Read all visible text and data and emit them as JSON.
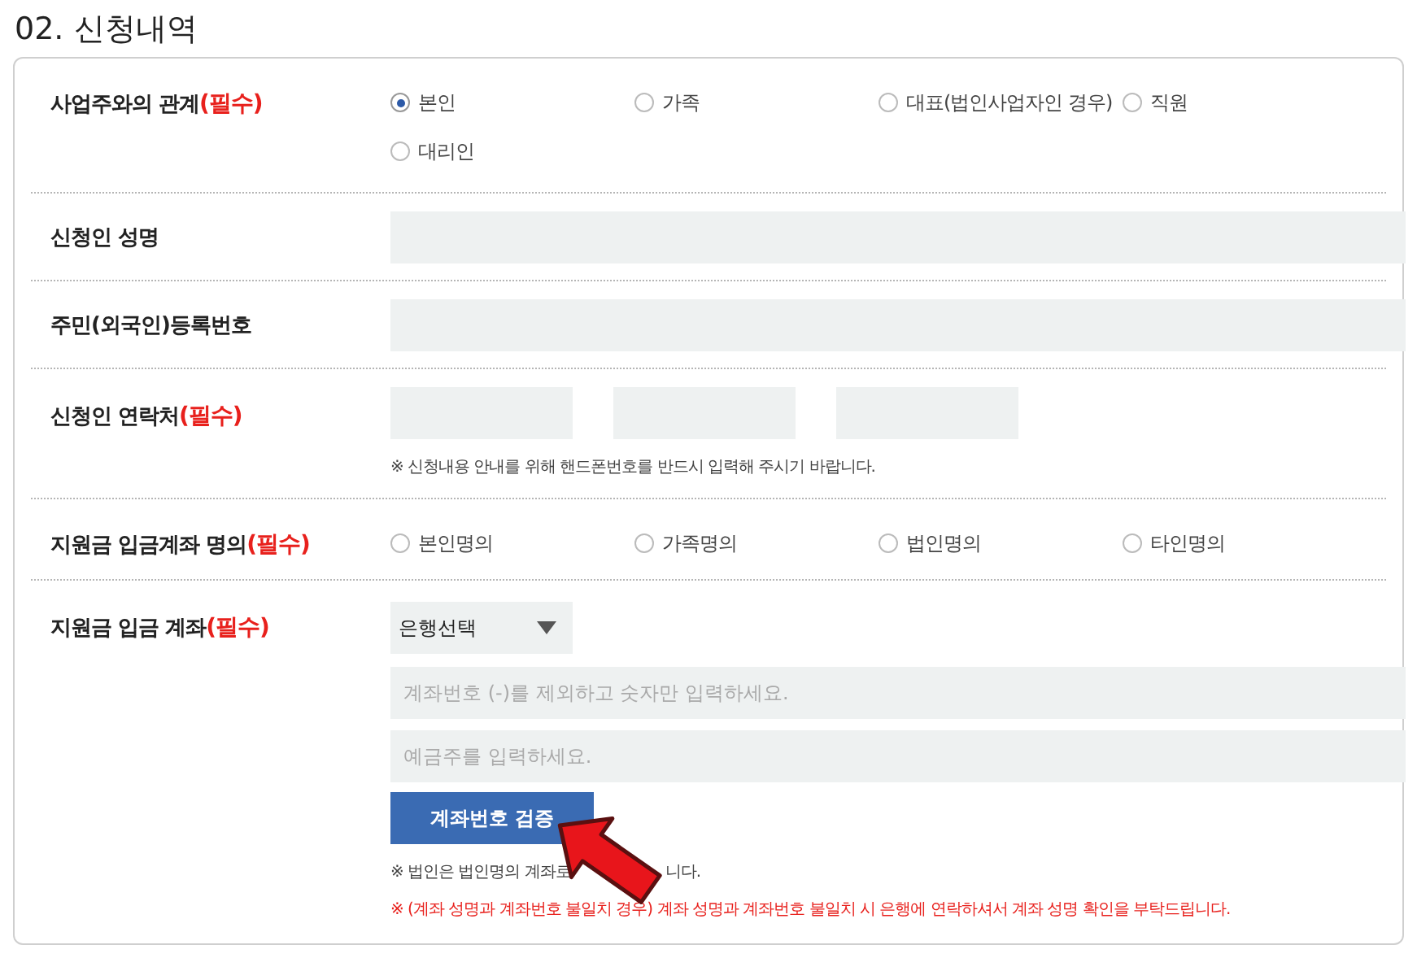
{
  "title": "02. 신청내역",
  "rows": [
    {
      "kind": "radio",
      "label": "사업주와의 관계",
      "required": "(필수)",
      "options": [
        {
          "label": "본인",
          "selected": true
        },
        {
          "label": "가족",
          "selected": false
        },
        {
          "label": "대표(법인사업자인 경우)",
          "selected": false
        },
        {
          "label": "직원",
          "selected": false
        },
        {
          "label": "대리인",
          "selected": false
        }
      ]
    },
    {
      "kind": "single-field",
      "label": "신청인 성명"
    },
    {
      "kind": "single-field",
      "label": "주민(외국인)등록번호"
    },
    {
      "kind": "phone",
      "label": "신청인 연락처",
      "required": "(필수)",
      "note": "※ 신청내용 안내를 위해 핸드폰번호를 반드시 입력해 주시기 바랍니다."
    },
    {
      "kind": "radio",
      "label": "지원금 입금계좌 명의",
      "required": "(필수)",
      "options": [
        {
          "label": "본인명의",
          "selected": false
        },
        {
          "label": "가족명의",
          "selected": false
        },
        {
          "label": "법인명의",
          "selected": false
        },
        {
          "label": "타인명의",
          "selected": false
        }
      ]
    },
    {
      "kind": "account",
      "label": "지원금 입금 계좌",
      "required": "(필수)",
      "bank_select": "은행선택",
      "account_placeholder": "계좌번호 (-)를 제외하고 숫자만 입력하세요.",
      "holder_placeholder": "예금주를 입력하세요.",
      "button": "계좌번호 검증",
      "notes": [
        {
          "kind": "plain",
          "fragments": [
            "※ 법인은 법인명의 계좌로",
            "니다."
          ]
        },
        {
          "kind": "warning",
          "fragments": [
            "※ (계좌 성명과 계좌번호 불일치 경우) 계좌 성명과 계좌번호 불일치 시 은행에 연락하셔서 계좌 성명 확인을 부탁드립니다."
          ]
        }
      ]
    }
  ]
}
